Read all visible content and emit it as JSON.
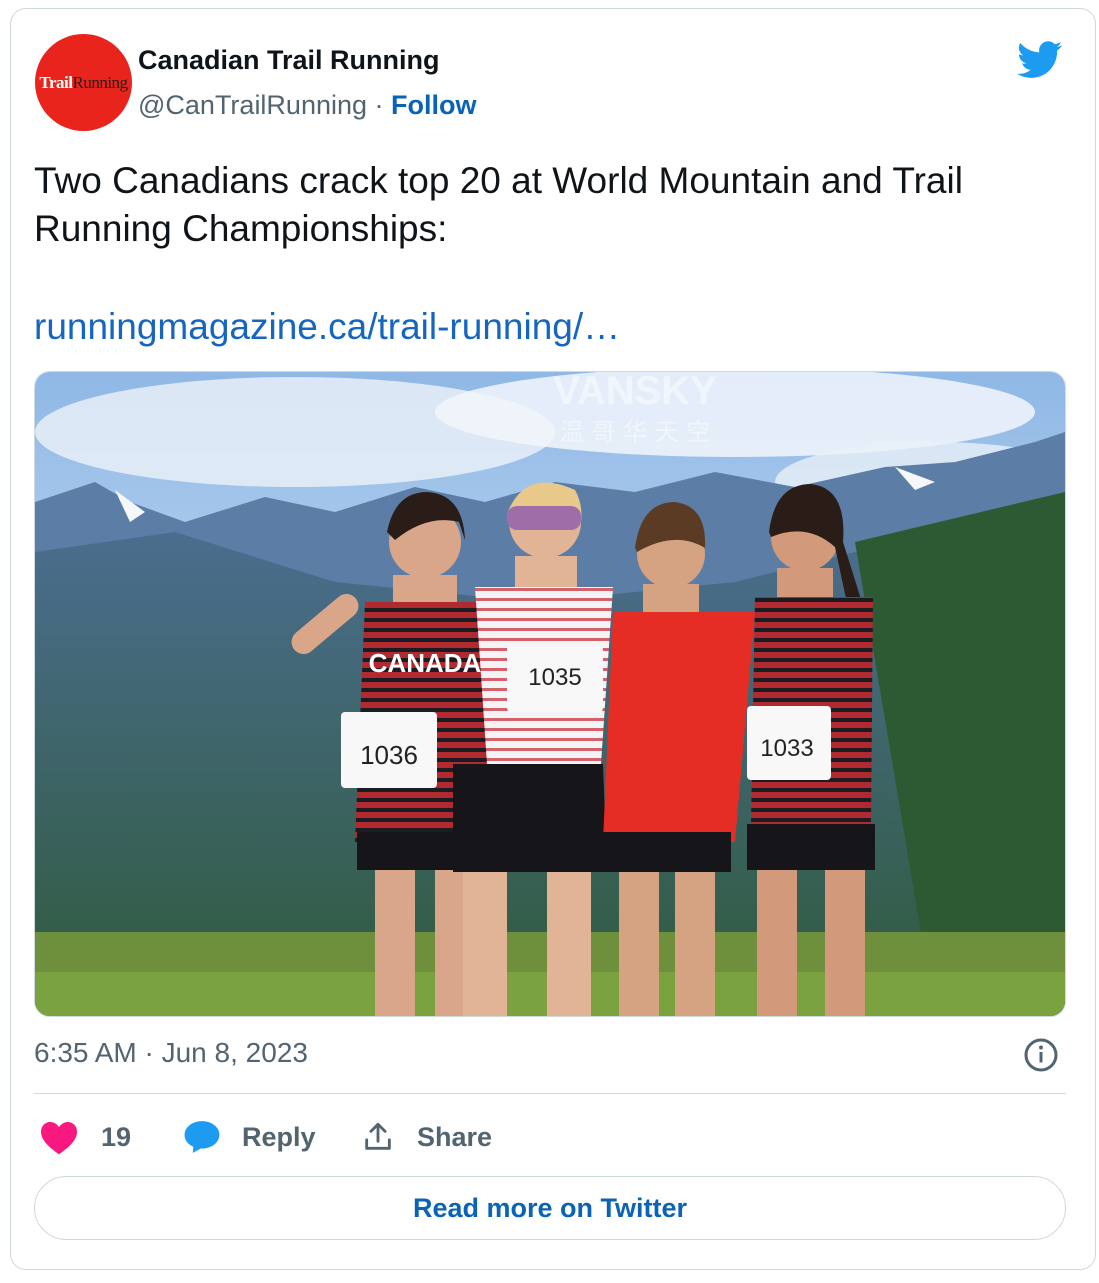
{
  "account": {
    "name": "Canadian Trail Running",
    "handle": "@CanTrailRunning",
    "separator": " · ",
    "follow_label": "Follow",
    "avatar_logo_part1": "Trail",
    "avatar_logo_part2": "Running"
  },
  "tweet": {
    "text": "Two Canadians crack top 20 at World Mountain and Trail Running Championships:",
    "link": "runningmagazine.ca/trail-running/…",
    "timestamp": "6:35 AM · Jun 8, 2023"
  },
  "photo": {
    "watermark_latin": "VANSKY",
    "watermark_cjk": "温 哥 华 天 空",
    "bibs": [
      "1036",
      "1035",
      "1033"
    ],
    "jersey_text": "CANADA"
  },
  "actions": {
    "likes_count": "19",
    "reply_label": "Reply",
    "share_label": "Share"
  },
  "read_more_label": "Read more on Twitter",
  "colors": {
    "avatar_red": "#e8241c",
    "twitter_blue": "#1d9bf0",
    "link_blue": "#1666c0",
    "like_pink": "#f91880",
    "secondary_text": "#536471"
  }
}
